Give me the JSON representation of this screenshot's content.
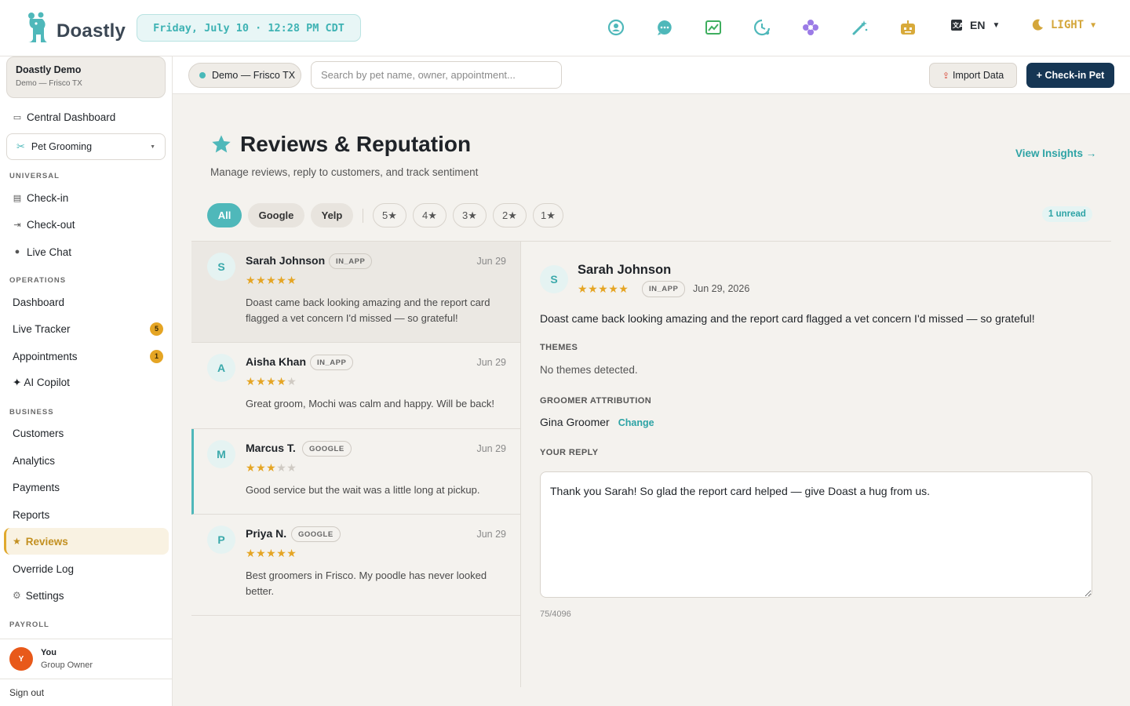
{
  "app": {
    "brand": "Doastly",
    "datetime": "Friday, July 10 · 12:28 PM CDT",
    "language": "EN",
    "theme": "LIGHT",
    "colors": {
      "accent": "#4fb8ba",
      "primary": "#163654",
      "star": "#e5a524"
    }
  },
  "toolbar_icons": [
    "profile-icon",
    "chat-icon",
    "chart-icon",
    "clock-icon",
    "flower-icon",
    "magic-wand-icon",
    "robot-icon"
  ],
  "sidebar": {
    "org_name": "Doastly Demo",
    "org_location": "Demo — Frisco TX",
    "central_dashboard": "Central Dashboard",
    "module": "Pet Grooming",
    "sections": {
      "universal": "UNIVERSAL",
      "operations": "OPERATIONS",
      "business": "BUSINESS",
      "payroll": "PAYROLL"
    },
    "universal": [
      "Check-in",
      "Check-out",
      "Live Chat"
    ],
    "operations": [
      {
        "label": "Dashboard",
        "badge": ""
      },
      {
        "label": "Live Tracker",
        "badge": "5"
      },
      {
        "label": "Appointments",
        "badge": "1"
      },
      {
        "label": "✦ AI Copilot",
        "badge": ""
      }
    ],
    "business": [
      "Customers",
      "Analytics",
      "Payments",
      "Reports",
      "Reviews",
      "Override Log",
      "Settings"
    ],
    "user": {
      "initial": "Y",
      "name": "You",
      "role": "Group Owner"
    },
    "signout": "Sign out"
  },
  "subheader": {
    "location": "Demo — Frisco TX",
    "search_placeholder": "Search by pet name, owner, appointment...",
    "import": "Import Data",
    "checkin": "+ Check-in Pet"
  },
  "page": {
    "title": "Reviews & Reputation",
    "subtitle": "Manage reviews, reply to customers, and track sentiment",
    "insights": "View Insights →",
    "unread": "1 unread"
  },
  "filters": [
    "All",
    "Google",
    "Yelp"
  ],
  "star_filters": [
    "5★",
    "4★",
    "3★",
    "2★",
    "1★"
  ],
  "reviews": [
    {
      "initial": "S",
      "name": "Sarah Johnson",
      "source": "IN_APP",
      "date": "Jun 29",
      "rating": 5,
      "text": "Doast came back looking amazing and the report card flagged a vet concern I'd missed — so grateful!"
    },
    {
      "initial": "A",
      "name": "Aisha Khan",
      "source": "IN_APP",
      "date": "Jun 29",
      "rating": 4,
      "text": "Great groom, Mochi was calm and happy. Will be back!"
    },
    {
      "initial": "M",
      "name": "Marcus T.",
      "source": "GOOGLE",
      "date": "Jun 29",
      "rating": 3,
      "text": "Good service but the wait was a little long at pickup."
    },
    {
      "initial": "P",
      "name": "Priya N.",
      "source": "GOOGLE",
      "date": "Jun 29",
      "rating": 5,
      "text": "Best groomers in Frisco. My poodle has never looked better."
    }
  ],
  "detail": {
    "initial": "S",
    "name": "Sarah Johnson",
    "rating": 5,
    "source": "IN_APP",
    "date": "Jun 29, 2026",
    "text": "Doast came back looking amazing and the report card flagged a vet concern I'd missed — so grateful!",
    "themes_label": "THEMES",
    "themes_value": "No themes detected.",
    "groomer_label": "GROOMER ATTRIBUTION",
    "groomer": "Gina Groomer",
    "change": "Change",
    "reply_label": "YOUR REPLY",
    "reply": "Thank you Sarah! So glad the report card helped — give Doast a hug from us.",
    "count": "75/4096"
  }
}
